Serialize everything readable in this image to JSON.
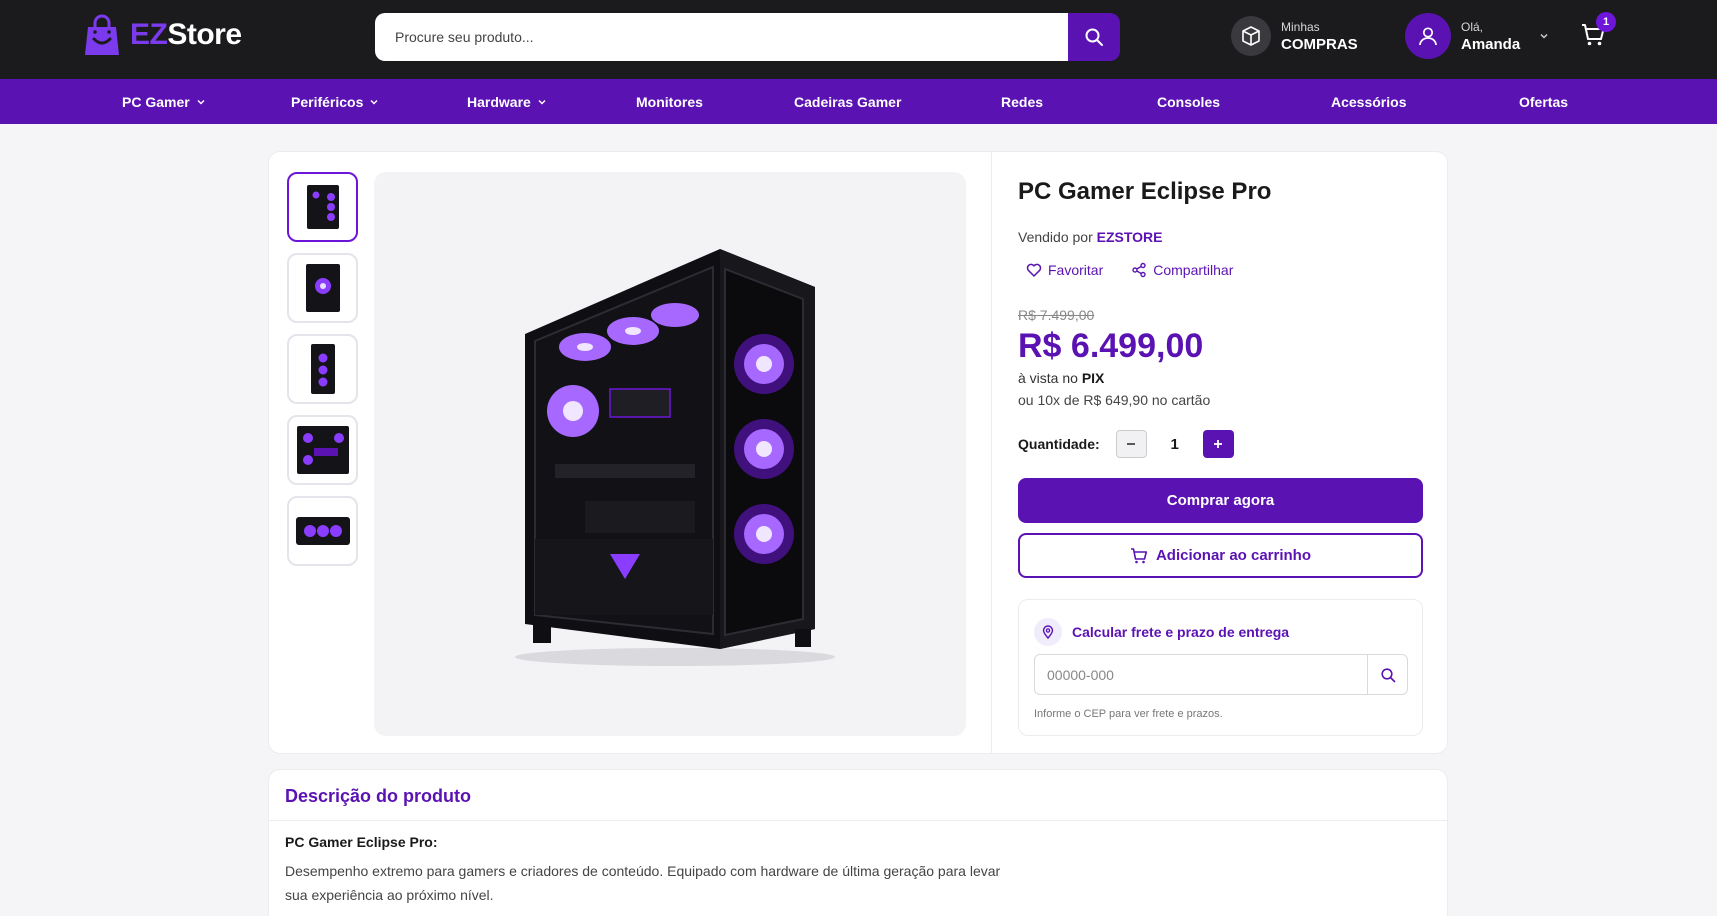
{
  "header": {
    "logo_ez": "EZ",
    "logo_store": "Store",
    "search_placeholder": "Procure seu produto...",
    "orders_small": "Minhas",
    "orders_big": "COMPRAS",
    "user_greeting": "Olá,",
    "user_name": "Amanda",
    "cart_count": "1"
  },
  "nav": {
    "items": [
      {
        "label": "PC Gamer",
        "dropdown": true
      },
      {
        "label": "Periféricos",
        "dropdown": true
      },
      {
        "label": "Hardware",
        "dropdown": true
      },
      {
        "label": "Monitores",
        "dropdown": false
      },
      {
        "label": "Cadeiras Gamer",
        "dropdown": false
      },
      {
        "label": "Redes",
        "dropdown": false
      },
      {
        "label": "Consoles",
        "dropdown": false
      },
      {
        "label": "Acessórios",
        "dropdown": false
      },
      {
        "label": "Ofertas",
        "dropdown": false
      }
    ]
  },
  "product": {
    "title": "PC Gamer Eclipse Pro",
    "sold_by_prefix": "Vendido por",
    "seller": "EZSTORE",
    "favorite_label": "Favoritar",
    "share_label": "Compartilhar",
    "old_price": "R$ 7.499,00",
    "price": "R$ 6.499,00",
    "pix_prefix": "à vista no",
    "pix_label": "PIX",
    "installments": "ou 10x de R$ 649,90 no cartão",
    "quantity_label": "Quantidade:",
    "quantity": "1",
    "buy_label": "Comprar agora",
    "add_cart_label": "Adicionar ao carrinho"
  },
  "freight": {
    "title": "Calcular frete e prazo de entrega",
    "placeholder": "00000-000",
    "hint": "Informe o CEP para ver frete e prazos."
  },
  "description": {
    "title": "Descrição do produto",
    "subtitle": "PC Gamer Eclipse Pro:",
    "text": "Desempenho extremo para gamers e criadores de conteúdo. Equipado com hardware de última geração para levar sua experiência ao próximo nível."
  },
  "colors": {
    "brand_purple": "#5b12b3",
    "header_bg": "#1b1b1d",
    "accent_purple": "#7c3aed"
  }
}
